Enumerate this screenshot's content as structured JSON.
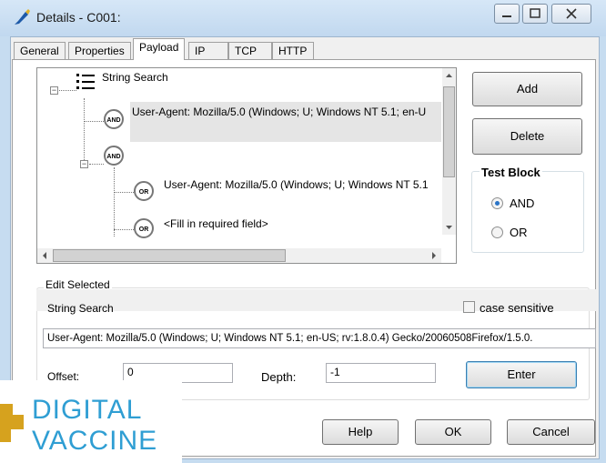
{
  "window": {
    "title": "Details - C001:"
  },
  "tabs": [
    {
      "label": "General"
    },
    {
      "label": "Properties"
    },
    {
      "label": "Payload"
    },
    {
      "label": "IP"
    },
    {
      "label": "TCP"
    },
    {
      "label": "HTTP"
    }
  ],
  "tree": {
    "root_label": "String Search",
    "and_badge": "AND",
    "or_badge": "OR",
    "node1_text": "User-Agent: Mozilla/5.0 (Windows; U; Windows NT 5.1; en-U",
    "node2_text": "User-Agent: Mozilla/5.0 (Windows; U; Windows NT 5.1",
    "node3_text": "<Fill in required field>"
  },
  "side": {
    "add_label": "Add",
    "delete_label": "Delete",
    "test_block_label": "Test Block",
    "and_label": "AND",
    "or_label": "OR",
    "selected": "AND"
  },
  "edit": {
    "section_label": "Edit Selected",
    "type_label": "String Search",
    "case_label": "case sensitive",
    "string_value": "User-Agent: Mozilla/5.0 (Windows; U; Windows NT 5.1; en-US; rv:1.8.0.4) Gecko/20060508Firefox/1.5.0.",
    "offset_label": "Offset:",
    "offset_value": "0",
    "depth_label": "Depth:",
    "depth_value": "-1",
    "enter_label": "Enter"
  },
  "footer": {
    "help_label": "Help",
    "ok_label": "OK",
    "cancel_label": "Cancel"
  },
  "logo": {
    "line1": "DIGITAL",
    "line2": "VACCINE",
    "color": "#2f9ed3",
    "accent": "#d6a21e"
  },
  "colors": {
    "radio_selected": "#2a74c7",
    "title_bar": "#c6dcf0"
  }
}
